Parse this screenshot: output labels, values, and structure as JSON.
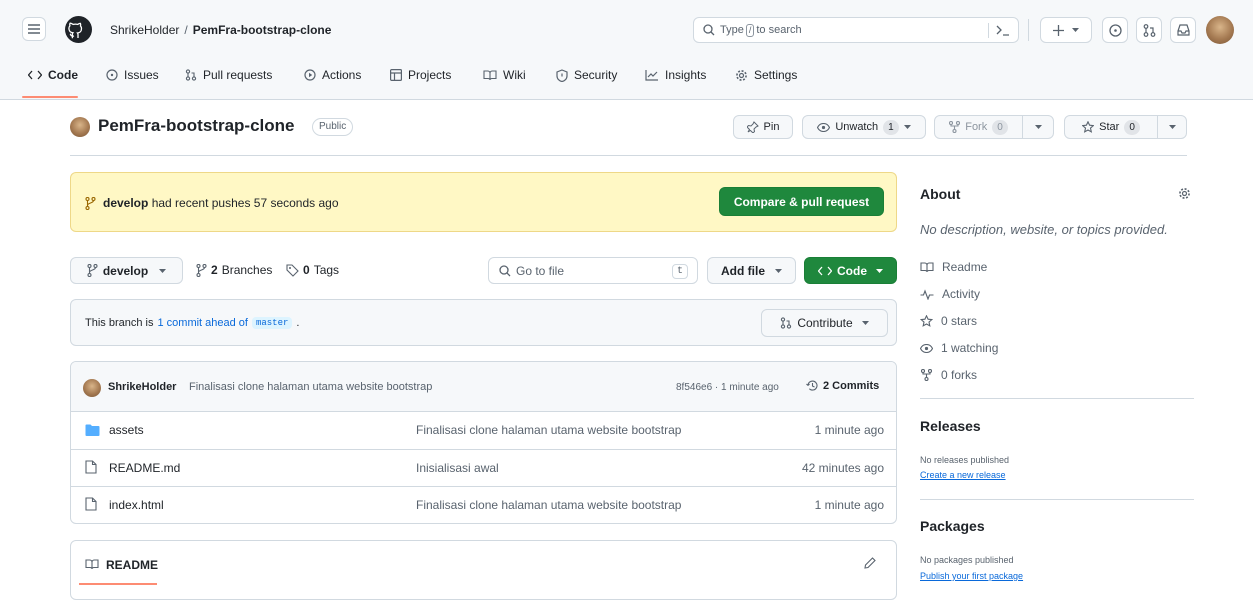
{
  "header": {
    "owner": "ShrikeHolder",
    "separator": "/",
    "repo": "PemFra-bootstrap-clone",
    "search_prefix": "Type",
    "search_key": "/",
    "search_suffix": "to search"
  },
  "tabs": [
    "Code",
    "Issues",
    "Pull requests",
    "Actions",
    "Projects",
    "Wiki",
    "Security",
    "Insights",
    "Settings"
  ],
  "repo_bar": {
    "title": "PemFra-bootstrap-clone",
    "visibility": "Public",
    "pin": "Pin",
    "unwatch": "Unwatch",
    "watch_count": "1",
    "fork": "Fork",
    "fork_count": "0",
    "star": "Star",
    "star_count": "0"
  },
  "banner": {
    "branch": "develop",
    "text": "had recent pushes 57 seconds ago",
    "button": "Compare & pull request"
  },
  "toolbar": {
    "branch": "develop",
    "branches_count": "2",
    "branches_label": "Branches",
    "tags_count": "0",
    "tags_label": "Tags",
    "goto_placeholder": "Go to file",
    "goto_key": "t",
    "add_file": "Add file",
    "code": "Code"
  },
  "ahead": {
    "prefix": "This branch is",
    "link": "1 commit ahead of",
    "branch": "master",
    "suffix": ".",
    "contribute": "Contribute"
  },
  "commit": {
    "author": "ShrikeHolder",
    "message": "Finalisasi clone halaman utama website bootstrap",
    "meta": "8f546e6 · 1 minute ago",
    "commits": "2 Commits"
  },
  "files": [
    {
      "name": "assets",
      "type": "folder",
      "message": "Finalisasi clone halaman utama website bootstrap",
      "time": "1 minute ago"
    },
    {
      "name": "README.md",
      "type": "file",
      "message": "Inisialisasi awal",
      "time": "42 minutes ago"
    },
    {
      "name": "index.html",
      "type": "file",
      "message": "Finalisasi clone halaman utama website bootstrap",
      "time": "1 minute ago"
    }
  ],
  "readme": {
    "label": "README"
  },
  "about": {
    "title": "About",
    "description": "No description, website, or topics provided.",
    "readme": "Readme",
    "activity": "Activity",
    "stars": "0 stars",
    "watching": "1 watching",
    "forks": "0 forks"
  },
  "releases": {
    "title": "Releases",
    "none": "No releases published",
    "create": "Create a new release"
  },
  "packages": {
    "title": "Packages",
    "none": "No packages published",
    "publish": "Publish your first package"
  },
  "colors": {
    "green": "#1f883d",
    "link": "#0969da",
    "banner": "#fff8c5",
    "active_tab": "#fd8c73"
  }
}
